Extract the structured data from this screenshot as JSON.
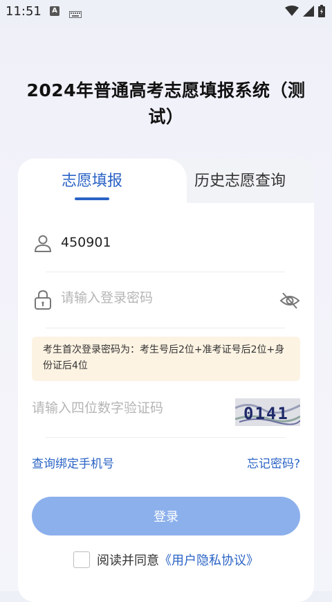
{
  "status_bar": {
    "time": "11:51",
    "a_badge": "A"
  },
  "title": "2024年普通高考志愿填报系统（测试）",
  "tabs": [
    {
      "label": "志愿填报",
      "active": true
    },
    {
      "label": "历史志愿查询",
      "active": false
    }
  ],
  "form": {
    "username_value": "450901",
    "password_placeholder": "请输入登录密码",
    "notice": "考生首次登录密码为：考生号后2位+准考证号后2位+身份证后4位",
    "captcha_placeholder": "请输入四位数字验证码",
    "captcha_text": "0141",
    "bind_phone_link": "查询绑定手机号",
    "forgot_password_link": "忘记密码?",
    "login_button": "登录",
    "agree_text": "阅读并同意",
    "agreement_link": "《用户隐私协议》"
  },
  "colors": {
    "accent": "#2a63c5",
    "button_disabled": "#8cb0ec",
    "notice_bg": "#fdf3e3"
  },
  "icons": [
    "user-icon",
    "lock-icon",
    "eye-off-icon",
    "wifi-icon",
    "signal-icon",
    "battery-icon",
    "keyboard-icon"
  ]
}
